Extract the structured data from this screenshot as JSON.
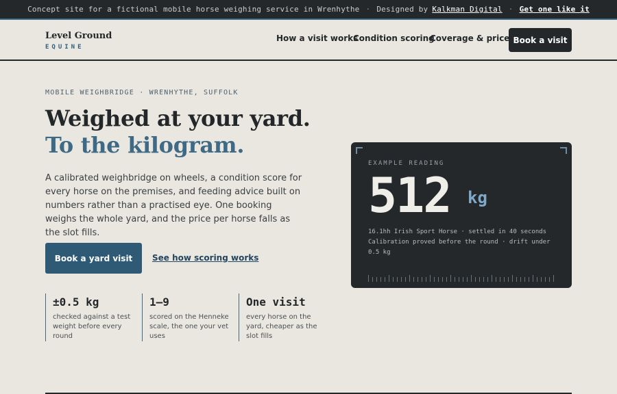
{
  "topbar": {
    "notice": "Concept site for a fictional mobile horse weighing service in Wrenhythe",
    "separator": "·",
    "designed_by": "Designed by",
    "designer": "Kalkman Digital",
    "cta": "Get one like it"
  },
  "header": {
    "brand_name": "Level Ground",
    "brand_sub": "EQUINE",
    "nav": [
      "How a visit works",
      "Condition scoring",
      "Coverage & prices"
    ],
    "book_button": "Book a visit"
  },
  "hero": {
    "eyebrow": "MOBILE WEIGHBRIDGE · WRENHYTHE, SUFFOLK",
    "title_line1": "Weighed at your yard.",
    "title_line2": "To the kilogram.",
    "lead": "A calibrated weighbridge on wheels, a condition score for every horse on the premises, and feeding advice built on numbers rather than a practised eye. One booking weighs the whole yard, and the price per horse falls as the slot fills.",
    "primary_button": "Book a yard visit",
    "secondary_link": "See how scoring works"
  },
  "stats": [
    {
      "value": "±0.5 kg",
      "caption": "checked against a test weight before every round"
    },
    {
      "value": "1–9",
      "caption": "scored on the Henneke scale, the one your vet uses"
    },
    {
      "value": "One visit",
      "caption": "every horse on the yard, cheaper as the slot fills"
    }
  ],
  "reading": {
    "label": "EXAMPLE READING",
    "value": "512",
    "unit": "kg",
    "detail_1": "16.1hh Irish Sport Horse · settled in 40 seconds",
    "detail_2": "Calibration proved before the round · drift under 0.5 kg"
  },
  "colors": {
    "background": "#e9e7df",
    "dark": "#25282b",
    "accent": "#3f6a86",
    "button_blue": "#2e5a76",
    "reading_unit": "#7fa9c8"
  }
}
